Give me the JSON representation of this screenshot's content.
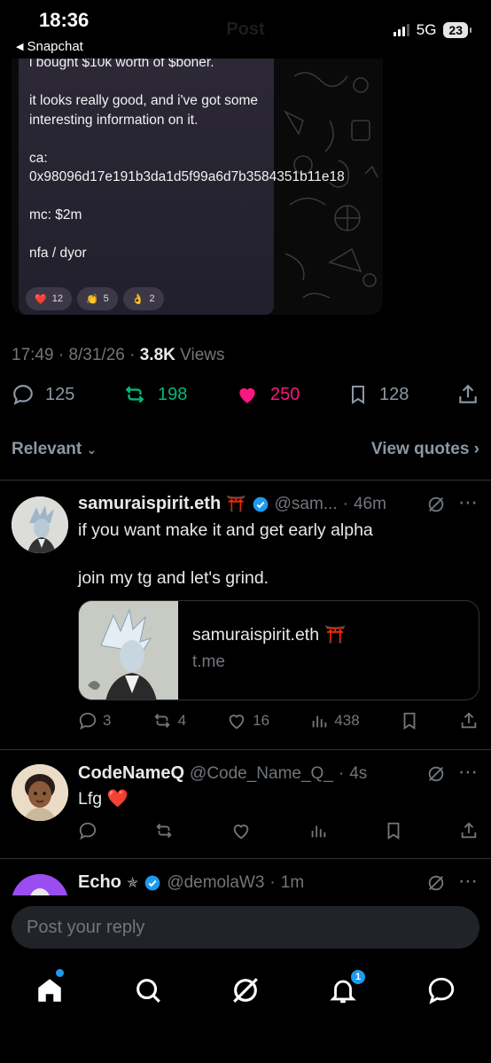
{
  "status": {
    "time": "18:36",
    "back_app": "Snapchat",
    "network": "5G",
    "battery": "23"
  },
  "header": {
    "title": "Post"
  },
  "embedded": {
    "text": "i bought $10k worth of $boner.\n\nit looks really good, and i've got some interesting information on it.\n\nca:\n0x98096d17e191b3da1d5f99a6d7b3584351b11e18\n\nmc: $2m\n\nnfa / dyor",
    "reactions": [
      {
        "emoji": "❤️",
        "count": "12"
      },
      {
        "emoji": "👏",
        "count": "5"
      },
      {
        "emoji": "👌",
        "count": "2"
      }
    ]
  },
  "post_meta": {
    "time": "17:49",
    "date": "8/31/26",
    "views_count": "3.8K",
    "views_label": "Views"
  },
  "post_stats": {
    "replies": "125",
    "reposts": "198",
    "likes": "250",
    "bookmarks": "128"
  },
  "sort": {
    "label": "Relevant",
    "view_quotes": "View quotes"
  },
  "replies": [
    {
      "name": "samuraispirit.eth",
      "name_emoji": "⛩️",
      "handle": "@sam...",
      "time": "46m",
      "text": "if you want make it and get early alpha\n\njoin my tg and let's grind.",
      "card": {
        "title": "samuraispirit.eth",
        "title_emoji": "⛩️",
        "domain": "t.me"
      },
      "actions": {
        "replies": "3",
        "reposts": "4",
        "likes": "16",
        "views": "438"
      }
    },
    {
      "name": "CodeNameQ",
      "handle": "@Code_Name_Q_",
      "time": "4s",
      "text": "Lfg ❤️"
    },
    {
      "name": "Echo",
      "name_emoji": "✯",
      "handle": "@demolaW3",
      "time": "1m"
    }
  ],
  "compose": {
    "placeholder": "Post your reply"
  },
  "nav": {
    "notifications_badge": "1"
  },
  "colors": {
    "accent": "#1d9bf0",
    "like": "#f91880",
    "repost": "#00ba7c",
    "muted": "#71767b"
  }
}
